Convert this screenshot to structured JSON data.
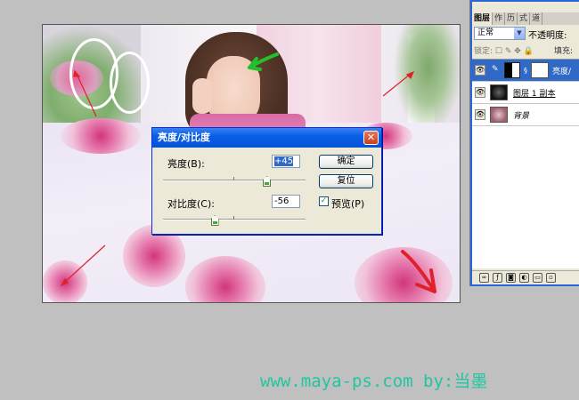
{
  "dialog": {
    "title": "亮度/对比度",
    "brightness_label": "亮度(B):",
    "brightness_value": "+45",
    "brightness_level": 0.725,
    "contrast_label": "对比度(C):",
    "contrast_value": "-56",
    "contrast_level": 0.36,
    "ok_label": "确定",
    "reset_label": "复位",
    "preview_label": "预览(P)",
    "preview_checked": true,
    "close_glyph": "✕"
  },
  "layers_panel": {
    "tabs": [
      "图层",
      "作",
      "历",
      "式",
      "道"
    ],
    "blend_mode": "正常",
    "opacity_label": "不透明度:",
    "lock_label": "锁定:",
    "fill_label": "填充:",
    "layers": [
      {
        "name": "亮度/",
        "type": "adjustment",
        "selected": true,
        "visible": true
      },
      {
        "name": "图层 1 副本",
        "type": "pixel",
        "selected": false,
        "visible": true
      },
      {
        "name": "背景",
        "type": "pixel",
        "selected": false,
        "visible": true
      }
    ]
  },
  "watermark": {
    "text": "www.maya-ps.com  by:当墨"
  },
  "colors": {
    "xp_blue": "#0453d6",
    "annotation_red": "#e0202a",
    "annotation_green": "#22c02a",
    "watermark": "#1fc6a2"
  }
}
